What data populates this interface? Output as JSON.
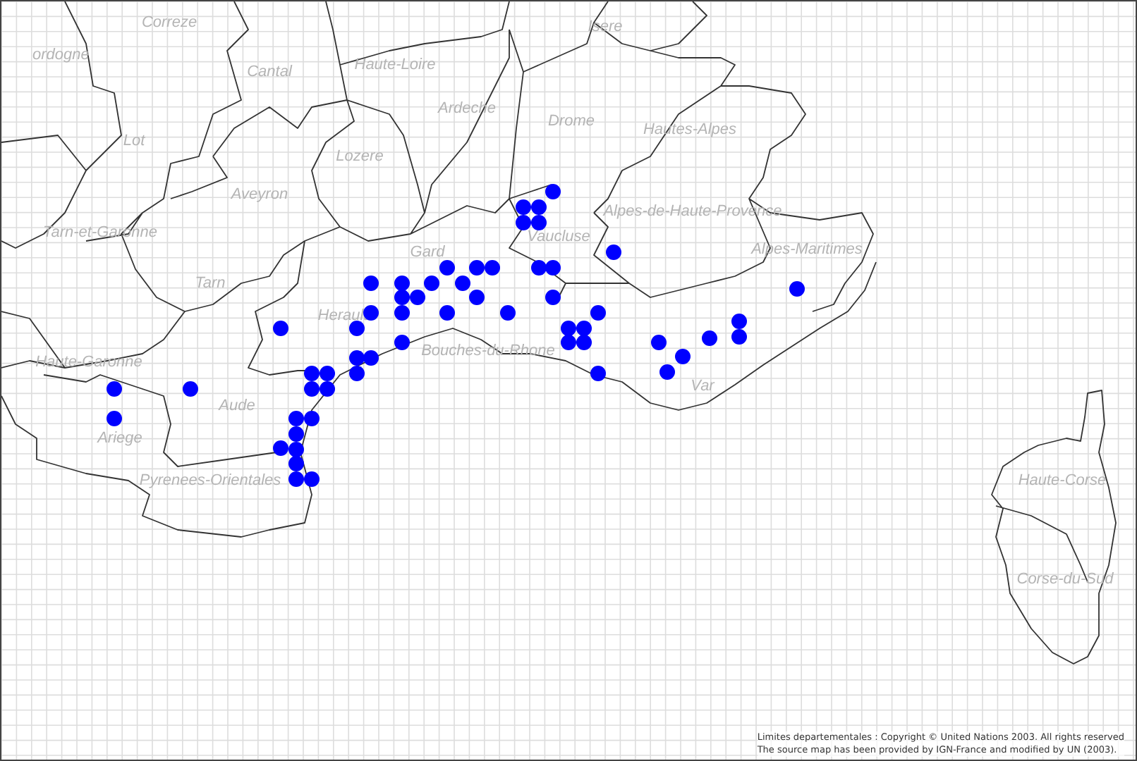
{
  "map": {
    "department_labels": [
      "Correze",
      "ordogne",
      "Cantal",
      "Haute-Loire",
      "Ardeche",
      "Drome",
      "Isere",
      "Hautes-Alpes",
      "Lot",
      "Lozere",
      "Aveyron",
      "Tarn-et-Garonne",
      "Tarn",
      "Gard",
      "Vaucluse",
      "Alpes-de-Haute-Provence",
      "Alpes-Maritimes",
      "Herault",
      "Bouches-du-Rhone",
      "Var",
      "Haute-Garonne",
      "Ariege",
      "Aude",
      "Pyrenees-Orientales",
      "Haute-Corse",
      "Corse-du-Sud"
    ]
  },
  "credits": [
    "Limites departementales : Copyright © United Nations 2003. All rights reserved",
    "The source map has been provided by IGN-France and modified by UN (2003)."
  ]
}
